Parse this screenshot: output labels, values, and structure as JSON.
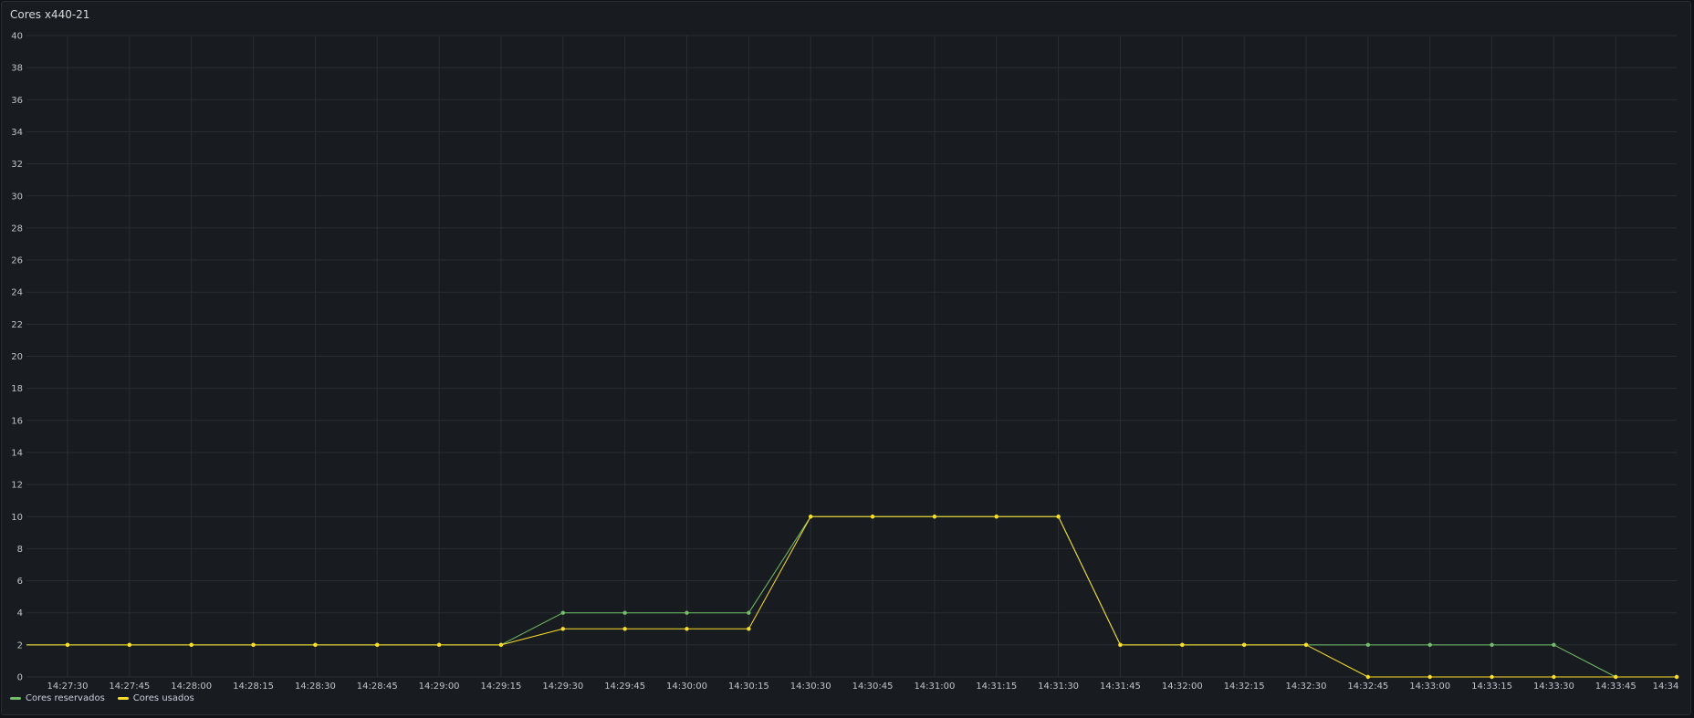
{
  "panel": {
    "title": "Cores x440-21"
  },
  "colors": {
    "background": "#181b1f",
    "grid": "#2a2d33",
    "reserved": "#73bf69",
    "used": "#fade2a"
  },
  "chart_data": {
    "type": "line",
    "title": "Cores x440-21",
    "xlabel": "",
    "ylabel": "",
    "ylim": [
      0,
      40
    ],
    "y_ticks": [
      0,
      2,
      4,
      6,
      8,
      10,
      12,
      14,
      16,
      18,
      20,
      22,
      24,
      26,
      28,
      30,
      32,
      34,
      36,
      38,
      40
    ],
    "x_tick_labels": [
      "14:27:30",
      "14:27:45",
      "14:28:00",
      "14:28:15",
      "14:28:30",
      "14:28:45",
      "14:29:00",
      "14:29:15",
      "14:29:30",
      "14:29:45",
      "14:30:00",
      "14:30:15",
      "14:30:30",
      "14:30:45",
      "14:31:00",
      "14:31:15",
      "14:31:30",
      "14:31:45",
      "14:32:00",
      "14:32:15",
      "14:32:30",
      "14:32:45",
      "14:33:00",
      "14:33:15",
      "14:33:30",
      "14:33:45",
      "14:34"
    ],
    "x": [
      "14:27:30",
      "14:27:45",
      "14:28:00",
      "14:28:15",
      "14:28:30",
      "14:28:45",
      "14:29:00",
      "14:29:15",
      "14:29:30",
      "14:29:45",
      "14:30:00",
      "14:30:15",
      "14:30:30",
      "14:30:45",
      "14:31:00",
      "14:31:15",
      "14:31:30",
      "14:31:45",
      "14:32:00",
      "14:32:15",
      "14:32:30",
      "14:32:45",
      "14:33:00",
      "14:33:15",
      "14:33:30",
      "14:33:45",
      "14:34:00"
    ],
    "grid": true,
    "legend_position": "bottom-left",
    "series": [
      {
        "name": "Cores reservados",
        "color": "#73bf69",
        "values": [
          2,
          2,
          2,
          2,
          2,
          2,
          2,
          2,
          4,
          4,
          4,
          4,
          10,
          10,
          10,
          10,
          10,
          2,
          2,
          2,
          2,
          2,
          2,
          2,
          2,
          0,
          0
        ]
      },
      {
        "name": "Cores usados",
        "color": "#fade2a",
        "values": [
          2,
          2,
          2,
          2,
          2,
          2,
          2,
          2,
          3,
          3,
          3,
          3,
          10,
          10,
          10,
          10,
          10,
          2,
          2,
          2,
          2,
          0,
          0,
          0,
          0,
          0,
          0
        ]
      }
    ]
  }
}
